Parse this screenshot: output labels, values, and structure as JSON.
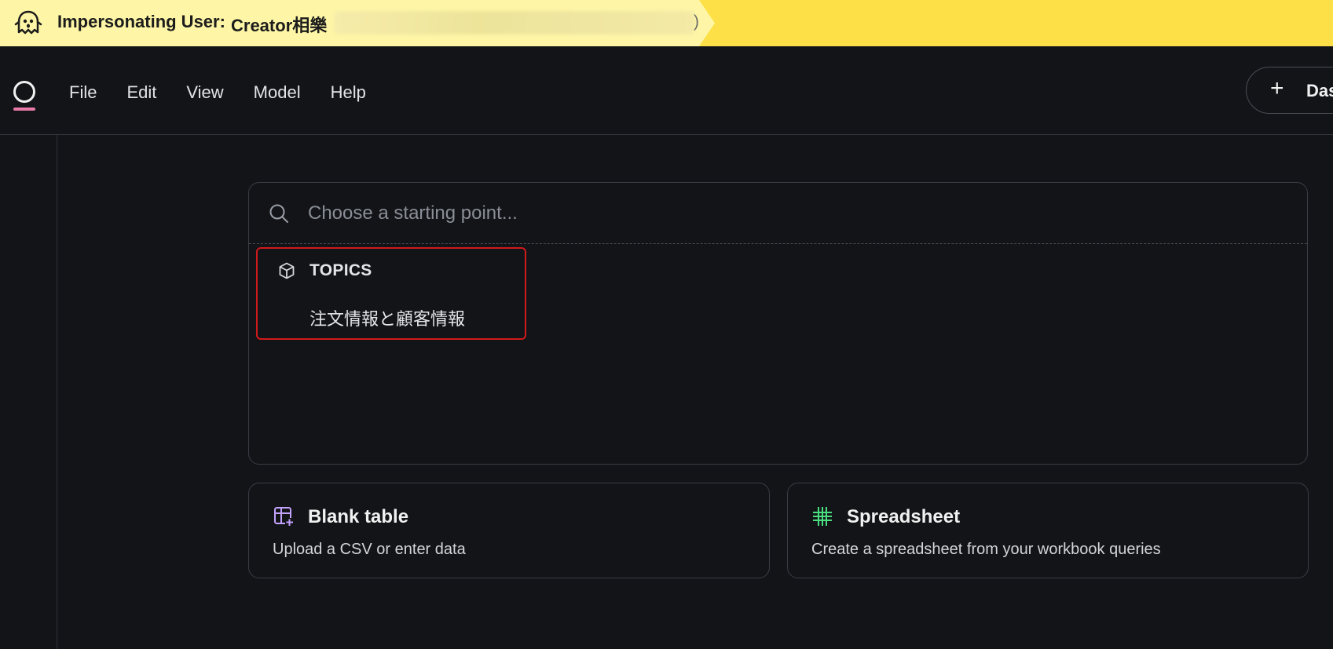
{
  "banner": {
    "label": "Impersonating User:",
    "user": "Creator相樂",
    "trailing": ")",
    "icon": "ghost-icon",
    "colors": {
      "left": "#fef6a6",
      "right": "#fde047"
    }
  },
  "topbar": {
    "menu": [
      "File",
      "Edit",
      "View",
      "Model",
      "Help"
    ],
    "add_button_label": "Das",
    "logo_accent": "#e879a9"
  },
  "search": {
    "placeholder": "Choose a starting point..."
  },
  "topics": {
    "heading": "TOPICS",
    "items": [
      "注文情報と顧客情報"
    ],
    "highlight_color": "#d11a1a"
  },
  "cards": [
    {
      "title": "Blank table",
      "description": "Upload a CSV or enter data",
      "icon": "table-plus-icon",
      "icon_color": "#c4a2ff"
    },
    {
      "title": "Spreadsheet",
      "description": "Create a spreadsheet from your workbook queries",
      "icon": "grid-hash-icon",
      "icon_color": "#4ade80"
    }
  ]
}
